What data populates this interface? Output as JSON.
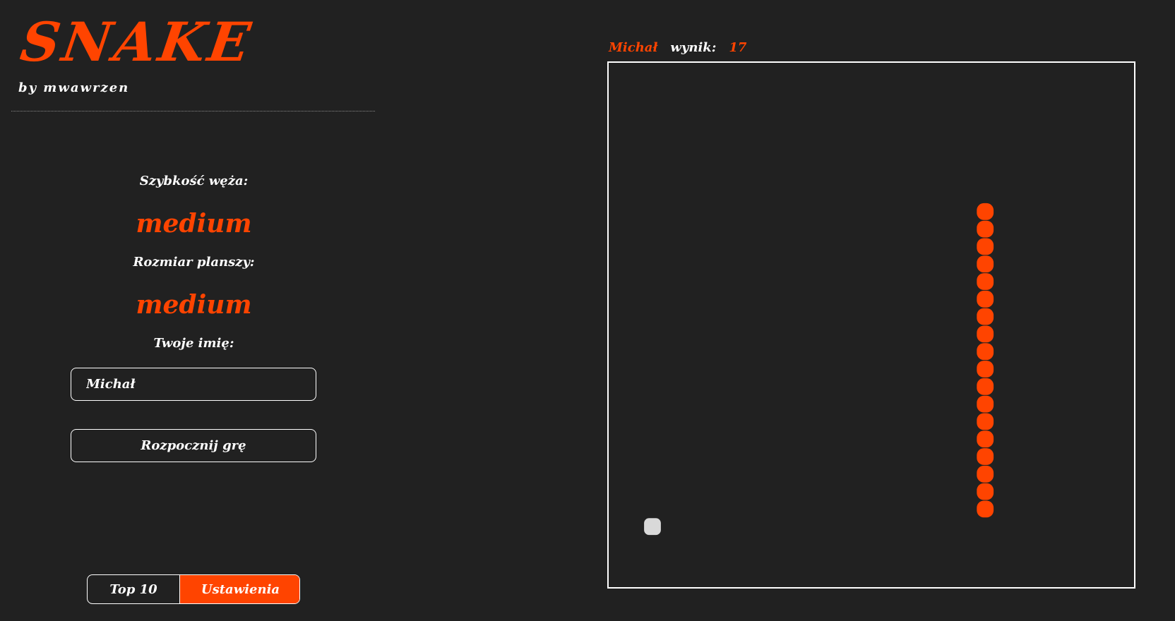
{
  "app": {
    "title": "SNAKE",
    "byline": "by mwawrzen"
  },
  "settings": {
    "speed_label": "Szybkość węża:",
    "speed_value": "medium",
    "board_size_label": "Rozmiar planszy:",
    "board_size_value": "medium",
    "name_label": "Twoje imię:",
    "name_value": "Michał",
    "start_label": "Rozpocznij grę"
  },
  "tabs": {
    "top10_label": "Top 10",
    "settings_label": "Ustawienia"
  },
  "scoreboard": {
    "player": "Michał",
    "score_label": "wynik:",
    "score_value": "17"
  },
  "game": {
    "grid_cells": 30,
    "snake": [
      {
        "col": 21,
        "row": 8
      },
      {
        "col": 21,
        "row": 9
      },
      {
        "col": 21,
        "row": 10
      },
      {
        "col": 21,
        "row": 11
      },
      {
        "col": 21,
        "row": 12
      },
      {
        "col": 21,
        "row": 13
      },
      {
        "col": 21,
        "row": 14
      },
      {
        "col": 21,
        "row": 15
      },
      {
        "col": 21,
        "row": 16
      },
      {
        "col": 21,
        "row": 17
      },
      {
        "col": 21,
        "row": 18
      },
      {
        "col": 21,
        "row": 19
      },
      {
        "col": 21,
        "row": 20
      },
      {
        "col": 21,
        "row": 21
      },
      {
        "col": 21,
        "row": 22
      },
      {
        "col": 21,
        "row": 23
      },
      {
        "col": 21,
        "row": 24
      },
      {
        "col": 21,
        "row": 25
      }
    ],
    "food": {
      "col": 2,
      "row": 26
    },
    "snake_color": "#ff4400",
    "food_color": "#d9d9d9",
    "accent_color": "#ff4400"
  }
}
